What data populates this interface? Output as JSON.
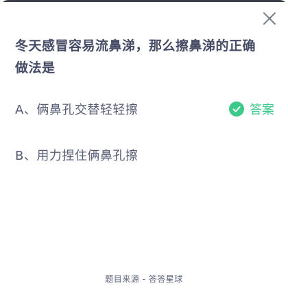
{
  "question": {
    "text": "冬天感冒容易流鼻涕，那么擦鼻涕的正确做法是"
  },
  "options": [
    {
      "label": "A、俩鼻孔交替轻轻擦",
      "is_answer": true
    },
    {
      "label": "B、用力捏住俩鼻孔擦",
      "is_answer": false
    }
  ],
  "answer_badge": {
    "label": "答案",
    "icon": "check-circle-icon",
    "color": "#3cc98a"
  },
  "close_icon": "close-icon",
  "footer": {
    "text": "题目来源 - 答答星球"
  },
  "colors": {
    "question_text": "#454b65",
    "option_text": "#565c74",
    "footer_text": "#5a6278",
    "accent_green": "#3cc98a"
  }
}
